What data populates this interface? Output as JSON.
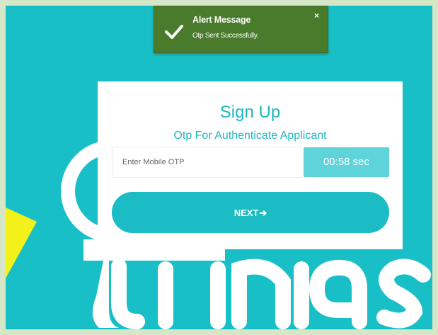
{
  "toast": {
    "title": "Alert Message",
    "message": "Otp Sent Successfully.",
    "close": "×",
    "icon": "check-icon",
    "color": "#4a7a2b"
  },
  "signup": {
    "title": "Sign Up",
    "subtitle": "Otp For Authenticate Applicant",
    "otp_placeholder": "Enter Mobile OTP",
    "otp_value": "",
    "timer": "00:58 sec",
    "next_label": "NEXT",
    "next_icon": "arrow-right-icon"
  },
  "colors": {
    "accent": "#1bbcc4",
    "background": "#19bfc6",
    "timer_bg": "#5ed3da",
    "toast_bg": "#4a7a2b"
  }
}
